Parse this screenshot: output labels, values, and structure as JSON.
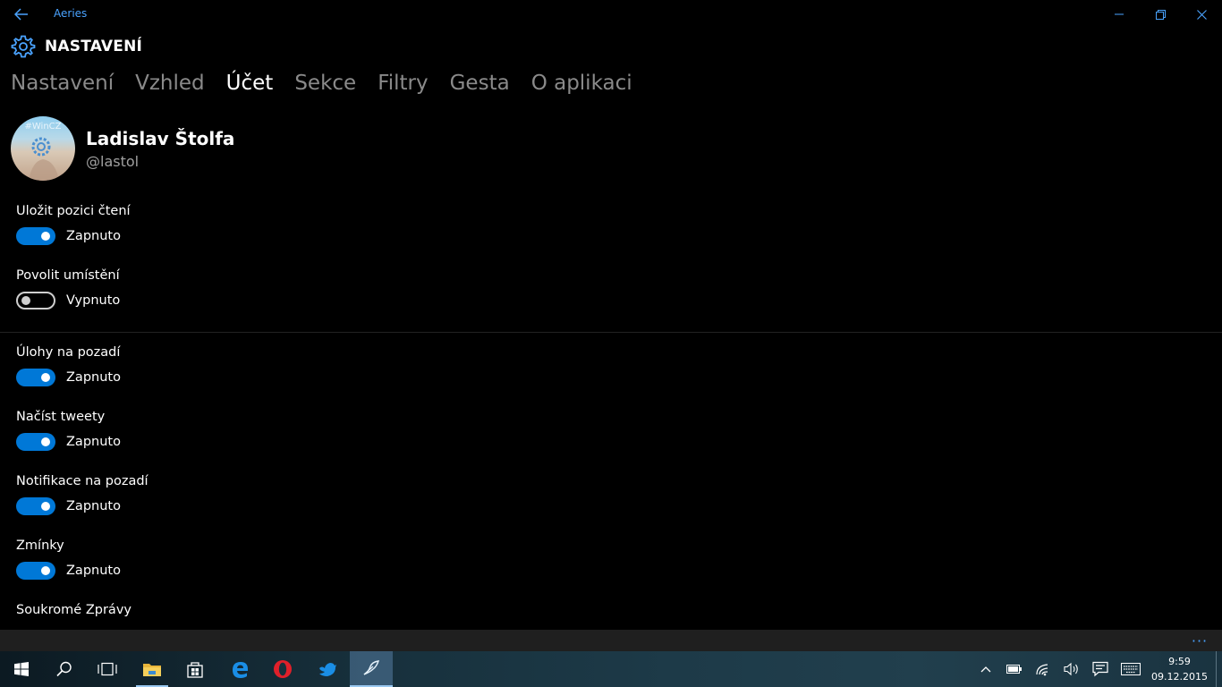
{
  "window": {
    "app_title": "Aeries"
  },
  "header": {
    "title": "NASTAVENÍ"
  },
  "tabs": [
    {
      "label": "Nastavení",
      "active": false
    },
    {
      "label": "Vzhled",
      "active": false
    },
    {
      "label": "Účet",
      "active": true
    },
    {
      "label": "Sekce",
      "active": false
    },
    {
      "label": "Filtry",
      "active": false
    },
    {
      "label": "Gesta",
      "active": false
    },
    {
      "label": "O aplikaci",
      "active": false
    }
  ],
  "profile": {
    "avatar_label": "#WinCZ",
    "name": "Ladislav Štolfa",
    "handle": "@lastol"
  },
  "settings": [
    {
      "label": "Uložit pozici čtení",
      "state": "Zapnuto",
      "on": true
    },
    {
      "label": "Povolit umístění",
      "state": "Vypnuto",
      "on": false
    },
    {
      "label": "Úlohy na pozadí",
      "state": "Zapnuto",
      "on": true
    },
    {
      "label": "Načíst tweety",
      "state": "Zapnuto",
      "on": true
    },
    {
      "label": "Notifikace na pozadí",
      "state": "Zapnuto",
      "on": true
    },
    {
      "label": "Zmínky",
      "state": "Zapnuto",
      "on": true
    },
    {
      "label": "Soukromé Zprávy",
      "state": "",
      "on": false
    }
  ],
  "appbar": {
    "more_label": "···"
  },
  "taskbar": {
    "time": "9:59",
    "date": "09.12.2015"
  },
  "colors": {
    "accent": "#0078d7",
    "title_link": "#4aa3ff",
    "tab_inactive": "#8a8a8a"
  }
}
